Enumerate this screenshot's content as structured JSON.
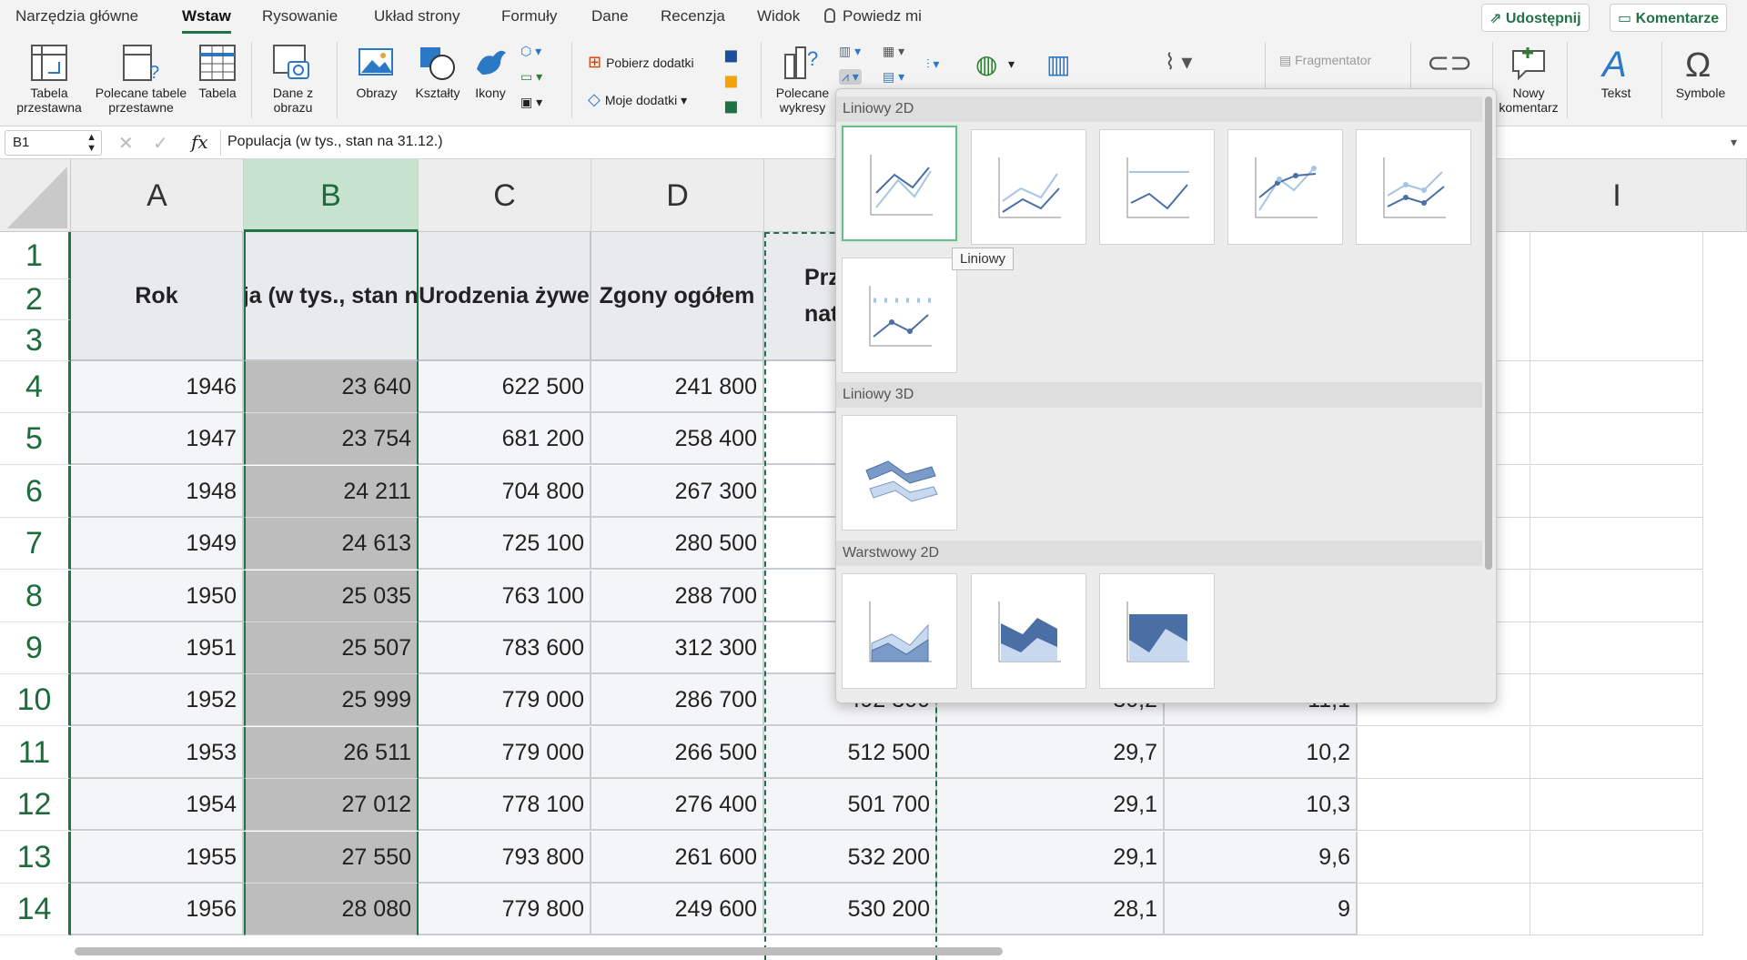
{
  "tabs": [
    "Narzędzia główne",
    "Wstaw",
    "Rysowanie",
    "Układ strony",
    "Formuły",
    "Dane",
    "Recenzja",
    "Widok",
    "Powiedz mi"
  ],
  "share_label": "Udostępnij",
  "comments_label": "Komentarze",
  "ribbon": {
    "pivot_table": "Tabela przestawna",
    "recommended_pivot": "Polecane tabele przestawne",
    "table": "Tabela",
    "data_from_picture": "Dane z obrazu",
    "pictures": "Obrazy",
    "shapes": "Kształty",
    "icons": "Ikony",
    "get_addins": "Pobierz dodatki",
    "my_addins": "Moje dodatki",
    "recommended_charts": "Polecane wykresy",
    "slicer": "Fragmentator",
    "new_comment": "Nowy komentarz",
    "text": "Tekst",
    "symbols": "Symbole"
  },
  "formula_bar": {
    "name_box": "B1",
    "fx": "fx",
    "content": "Populacja (w tys., stan na 31.12.)"
  },
  "columns": [
    "A",
    "B",
    "C",
    "D",
    "I"
  ],
  "row_numbers": [
    "1",
    "2",
    "3",
    "4",
    "5",
    "6",
    "7",
    "8",
    "9",
    "10",
    "11",
    "12",
    "13",
    "14"
  ],
  "headers": {
    "rok": "Rok",
    "populacja": "Populacja (w tys., stan na 31.12.)",
    "urodzenia": "Urodzenia żywe",
    "zgony": "Zgony ogółem",
    "przyrost": "Przyrost naturalny"
  },
  "header_visible": {
    "przyrost_line1": "Prz",
    "przyrost_line2": "nat"
  },
  "rows": [
    [
      "1946",
      "23 640",
      "622 500",
      "241 800",
      "",
      "",
      ""
    ],
    [
      "1947",
      "23 754",
      "681 200",
      "258 400",
      "",
      "",
      ""
    ],
    [
      "1948",
      "24 211",
      "704 800",
      "267 300",
      "",
      "",
      ""
    ],
    [
      "1949",
      "24 613",
      "725 100",
      "280 500",
      "",
      "",
      ""
    ],
    [
      "1950",
      "25 035",
      "763 100",
      "288 700",
      "",
      "",
      ""
    ],
    [
      "1951",
      "25 507",
      "783 600",
      "312 300",
      "",
      "",
      ""
    ],
    [
      "1952",
      "25 999",
      "779 000",
      "286 700",
      "492 300",
      "30,2",
      "11,1"
    ],
    [
      "1953",
      "26 511",
      "779 000",
      "266 500",
      "512 500",
      "29,7",
      "10,2"
    ],
    [
      "1954",
      "27 012",
      "778 100",
      "276 400",
      "501 700",
      "29,1",
      "10,3"
    ],
    [
      "1955",
      "27 550",
      "793 800",
      "261 600",
      "532 200",
      "29,1",
      "9,6"
    ],
    [
      "1956",
      "28 080",
      "779 800",
      "249 600",
      "530 200",
      "28,1",
      "9"
    ]
  ],
  "popup": {
    "section_line2d": "Liniowy 2D",
    "section_line3d": "Liniowy 3D",
    "section_area2d": "Warstwowy 2D",
    "tooltip": "Liniowy"
  }
}
